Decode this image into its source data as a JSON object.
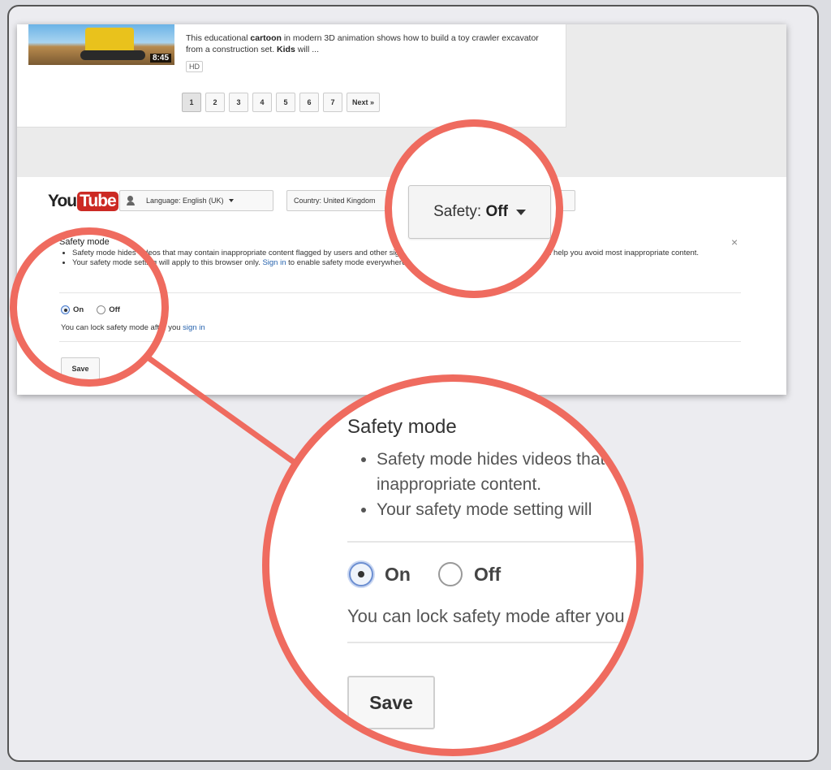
{
  "results": {
    "thumbnail_duration": "8:45",
    "description_parts": [
      "This educational ",
      "cartoon",
      " in modern 3D animation shows how to build a toy crawler excavator from a construction set. ",
      "Kids",
      " will ..."
    ],
    "hd_badge": "HD",
    "pagination": {
      "pages": [
        "1",
        "2",
        "3",
        "4",
        "5",
        "6",
        "7"
      ],
      "active": "1",
      "next_label": "Next »"
    }
  },
  "footer": {
    "logo_you": "You",
    "logo_tube": "Tube",
    "language_label": "Language: English (UK)",
    "country_label": "Country: United Kingdom",
    "safety_label_prefix": "Safety: ",
    "safety_label_value": "Off",
    "close_symbol": "×"
  },
  "safety_panel": {
    "title": "Safety mode",
    "bullet1": "Safety mode hides videos that may contain inappropriate content flagged by users and other signals. No filter is 100% accurate, but it should help you avoid most inappropriate content.",
    "bullet2_pre": "Your safety mode setting will apply to this browser only. ",
    "bullet2_link": "Sign in",
    "bullet2_post": " to enable safety mode everywhere.",
    "on_label": "On",
    "off_label": "Off",
    "lock_pre": "You can lock safety mode after you ",
    "lock_link": "sign in",
    "save_label": "Save"
  },
  "zoom": {
    "title": "Safety mode",
    "bullet1": "Safety mode hides videos that may contain",
    "bullet1_cont": "inappropriate content.",
    "bullet2": "Your safety mode setting will",
    "on_label": "On",
    "off_label": "Off",
    "lock_text": "You can lock safety mode after you",
    "save_label": "Save"
  },
  "colors": {
    "highlight_circle": "#ef6b5f",
    "youtube_red": "#cc2a24",
    "link": "#2763ae"
  }
}
